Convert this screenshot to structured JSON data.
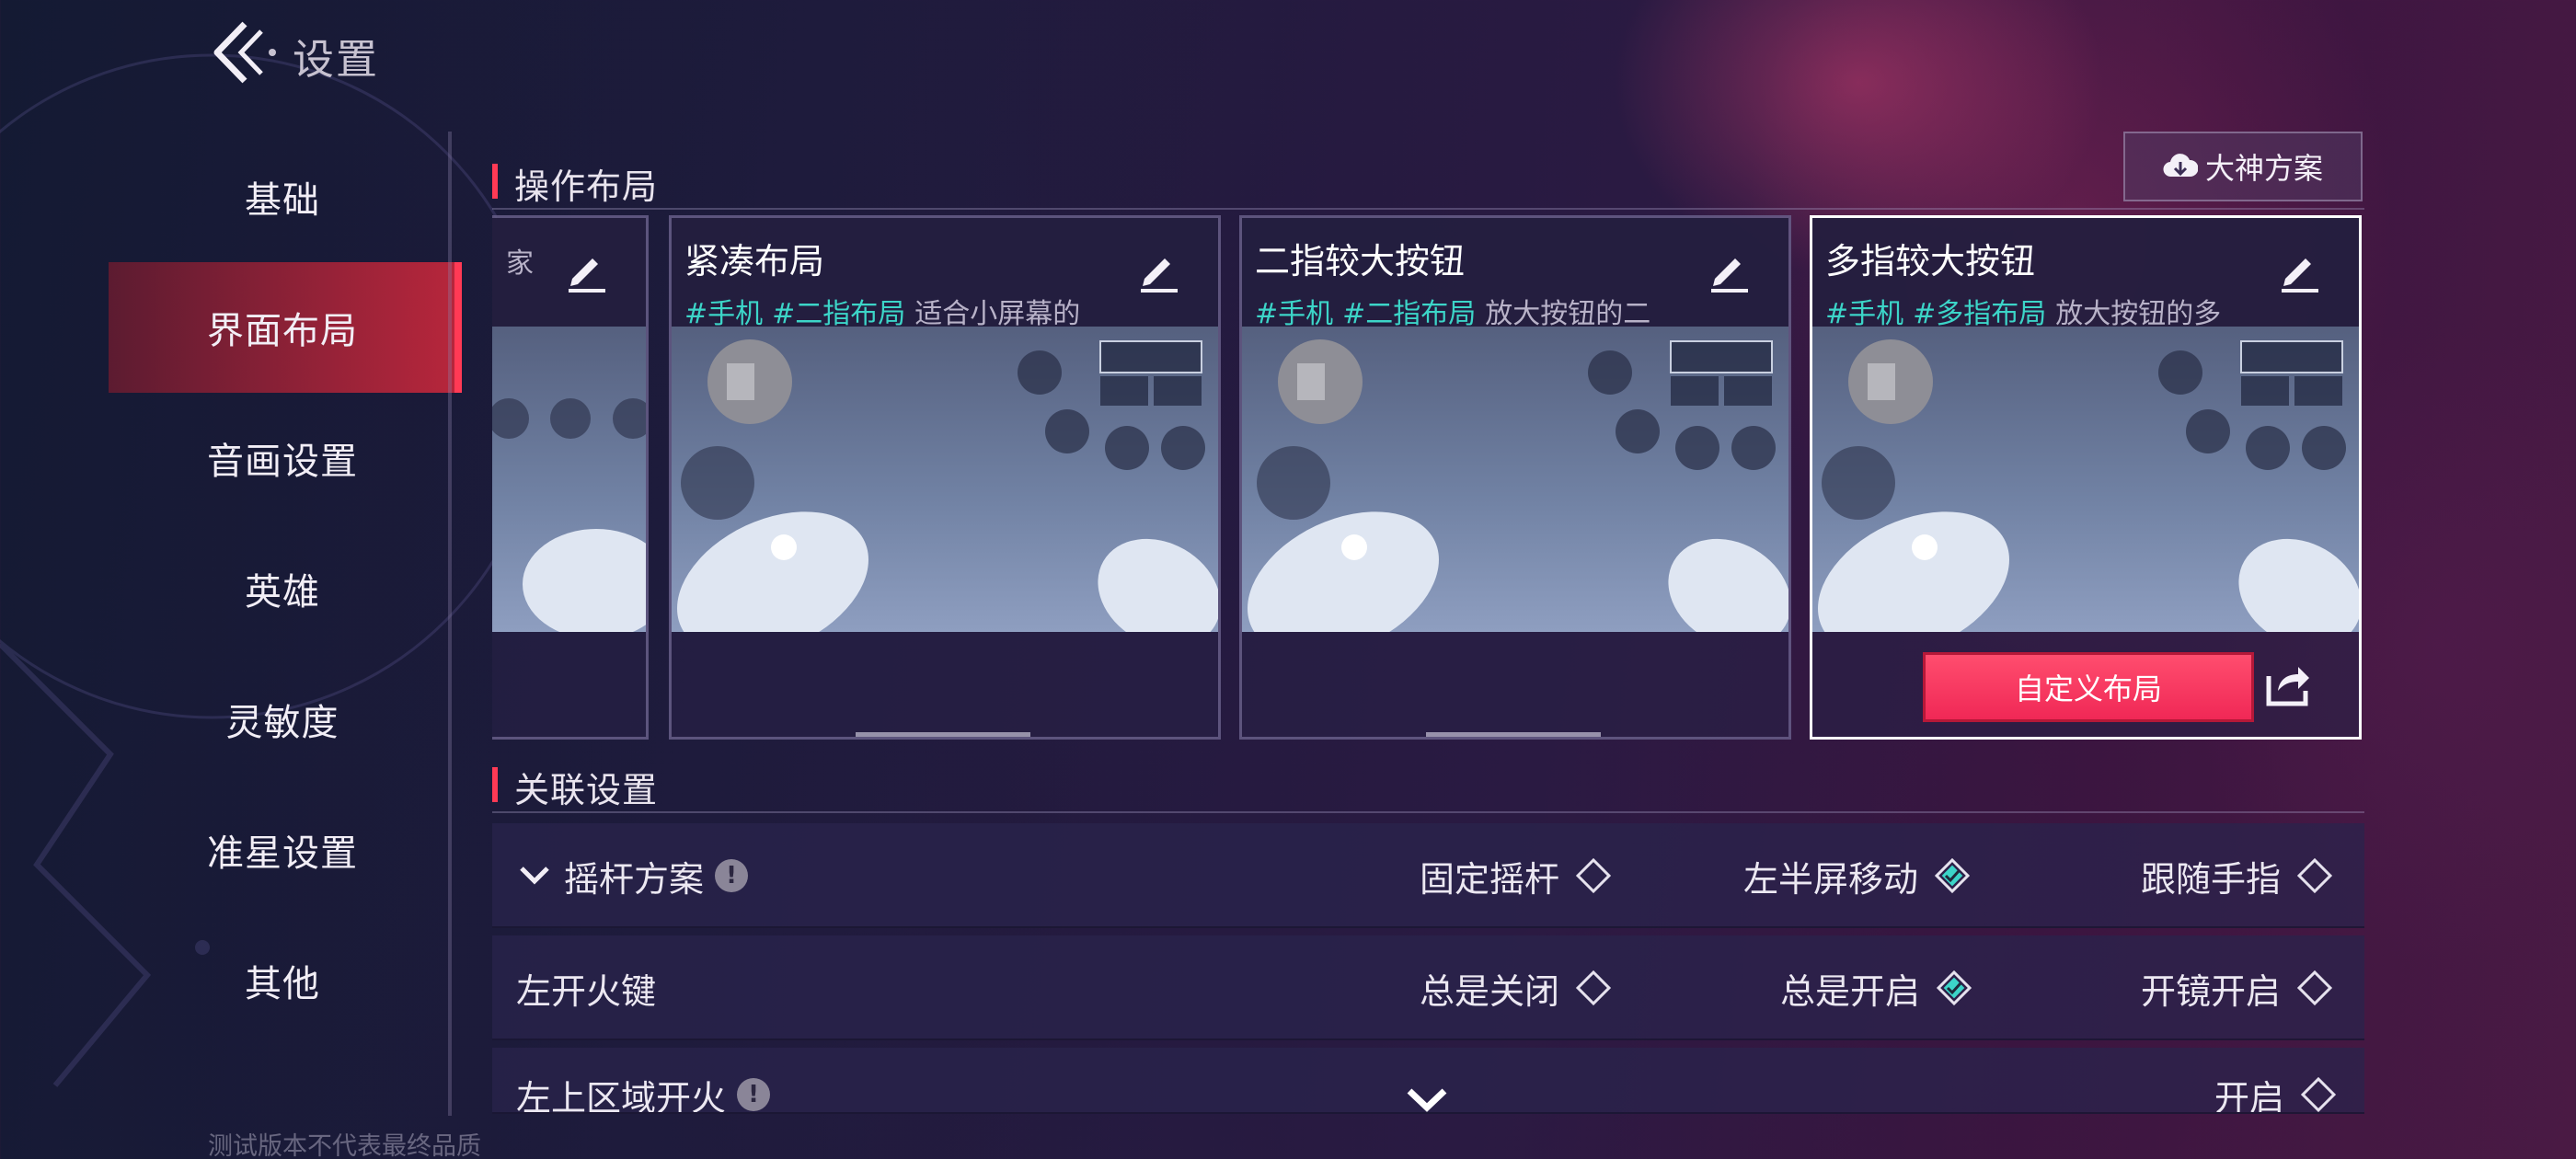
{
  "header": {
    "title": "设置"
  },
  "sidebar": {
    "items": [
      {
        "label": "基础"
      },
      {
        "label": "界面布局"
      },
      {
        "label": "音画设置"
      },
      {
        "label": "英雄"
      },
      {
        "label": "灵敏度"
      },
      {
        "label": "准星设置"
      },
      {
        "label": "其他"
      }
    ],
    "active_index": 1
  },
  "layout_section": {
    "title": "操作布局",
    "master_button": "大神方案",
    "cards": [
      {
        "title": "",
        "tags": [],
        "desc": "家"
      },
      {
        "title": "紧凑布局",
        "tags": [
          "#手机",
          "#二指布局"
        ],
        "desc": "适合小屏幕的"
      },
      {
        "title": "二指较大按钮",
        "tags": [
          "#手机",
          "#二指布局"
        ],
        "desc": "放大按钮的二"
      },
      {
        "title": "多指较大按钮",
        "tags": [
          "#手机",
          "#多指布局"
        ],
        "desc": "放大按钮的多",
        "selected": true,
        "custom_button": "自定义布局"
      }
    ]
  },
  "related_section": {
    "title": "关联设置",
    "rows": [
      {
        "label": "摇杆方案",
        "has_info": true,
        "expandable": true,
        "options": [
          {
            "label": "固定摇杆",
            "selected": false
          },
          {
            "label": "左半屏移动",
            "selected": true
          },
          {
            "label": "跟随手指",
            "selected": false
          }
        ]
      },
      {
        "label": "左开火键",
        "has_info": false,
        "options": [
          {
            "label": "总是关闭",
            "selected": false
          },
          {
            "label": "总是开启",
            "selected": true
          },
          {
            "label": "开镜开启",
            "selected": false
          }
        ]
      },
      {
        "label": "左上区域开火",
        "has_info": true,
        "options": [
          {
            "label": "开启",
            "selected": false
          }
        ]
      }
    ]
  },
  "watermark": "测试版本不代表最终品质",
  "colors": {
    "accent": "#ff3a55",
    "tag": "#3cd5c8",
    "selected_diamond": "#3cd5c8"
  }
}
